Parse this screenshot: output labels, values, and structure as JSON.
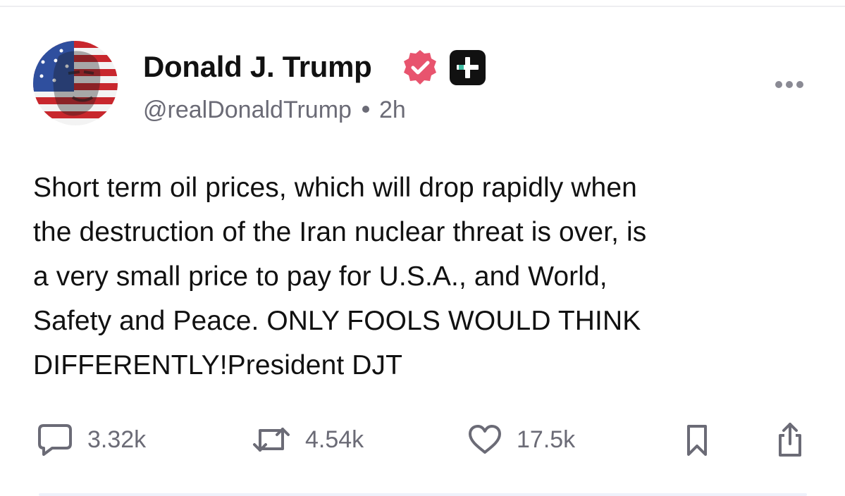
{
  "post": {
    "author": {
      "display_name": "Donald J. Trump",
      "handle": "@realDonaldTrump",
      "verified": true,
      "avatar_icon": "flag-portrait-avatar",
      "badge_icon": "plus-badge-icon"
    },
    "time_ago": "2h",
    "text_lines": [
      "Short term oil prices, which will drop rapidly when",
      "the destruction of the Iran nuclear threat is over, is",
      "a very small price to pay for U.S.A., and World,",
      "Safety and Peace. ONLY FOOLS WOULD THINK",
      "DIFFERENTLY!President DJT"
    ],
    "stats": {
      "replies": "3.32k",
      "reposts": "4.54k",
      "likes": "17.5k"
    }
  },
  "colors": {
    "text": "#111111",
    "muted": "#6b6b76",
    "verified": "#e8546e",
    "badge": "#111111",
    "badge_accent": "#3dbba0"
  }
}
